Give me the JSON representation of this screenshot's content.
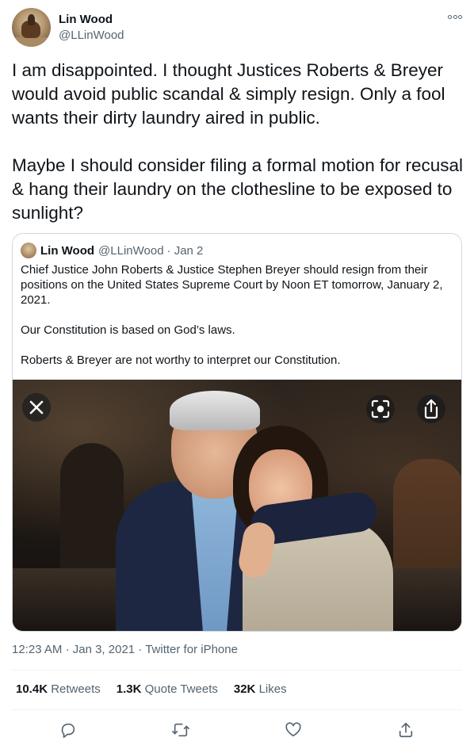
{
  "author": {
    "name": "Lin Wood",
    "handle": "@LLinWood"
  },
  "tweet": {
    "text": "I am disappointed. I thought Justices Roberts & Breyer would avoid public scandal & simply resign. Only a fool wants their dirty laundry aired in public.\n\nMaybe I should consider filing a formal motion for recusal & hang their laundry on the clothesline to be exposed to sunlight?"
  },
  "quote": {
    "name": "Lin Wood",
    "handle": "@LLinWood",
    "date": "· Jan 2",
    "paragraphs": [
      "Chief Justice John Roberts & Justice Stephen Breyer should resign from their positions on the United States Supreme Court by Noon ET tomorrow, January 2, 2021.",
      "Our Constitution is based on God’s laws.",
      "Roberts & Breyer are not worthy to interpret our Constitution."
    ]
  },
  "meta": {
    "time": "12:23 AM",
    "date": "Jan 3, 2021",
    "source": "Twitter for iPhone"
  },
  "stats": {
    "retweets_count": "10.4K",
    "retweets_label": "Retweets",
    "quotes_count": "1.3K",
    "quotes_label": "Quote Tweets",
    "likes_count": "32K",
    "likes_label": "Likes"
  },
  "icons": {
    "more": "more-icon",
    "close": "close-icon",
    "scan": "scan-icon",
    "share": "share-icon",
    "reply": "reply-icon",
    "retweet": "retweet-icon",
    "like": "like-icon"
  },
  "colors": {
    "text_primary": "#0f1419",
    "text_secondary": "#536471",
    "border": "#cfd9de",
    "divider": "#eff3f4"
  }
}
